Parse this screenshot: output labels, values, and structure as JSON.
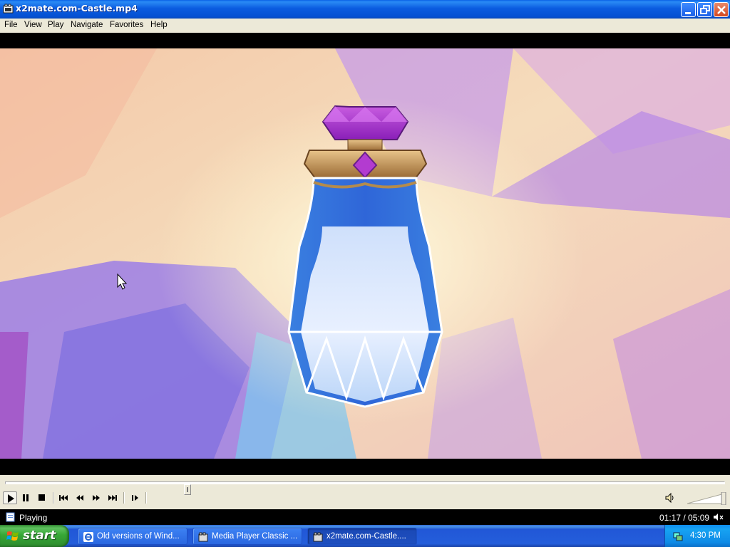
{
  "window": {
    "title": "x2mate.com-Castle.mp4"
  },
  "menu": {
    "items": [
      "File",
      "View",
      "Play",
      "Navigate",
      "Favorites",
      "Help"
    ]
  },
  "playback": {
    "position_fraction": 0.253
  },
  "status": {
    "text": "Playing",
    "time": "01:17 / 05:09"
  },
  "taskbar": {
    "start_label": "start",
    "tasks": [
      {
        "label": "Old versions of Wind...",
        "icon": "ie-icon",
        "active": false
      },
      {
        "label": "Media Player Classic ...",
        "icon": "media-player-icon",
        "active": false
      },
      {
        "label": "x2mate.com-Castle....",
        "icon": "media-player-icon",
        "active": true
      }
    ],
    "clock": "4:30 PM"
  },
  "colors": {
    "title_bar": "#0a5be0",
    "menu_bg": "#ece9d8",
    "start_green": "#3aa23a",
    "taskbar_blue": "#245edb",
    "tray_blue": "#0f8ded"
  }
}
